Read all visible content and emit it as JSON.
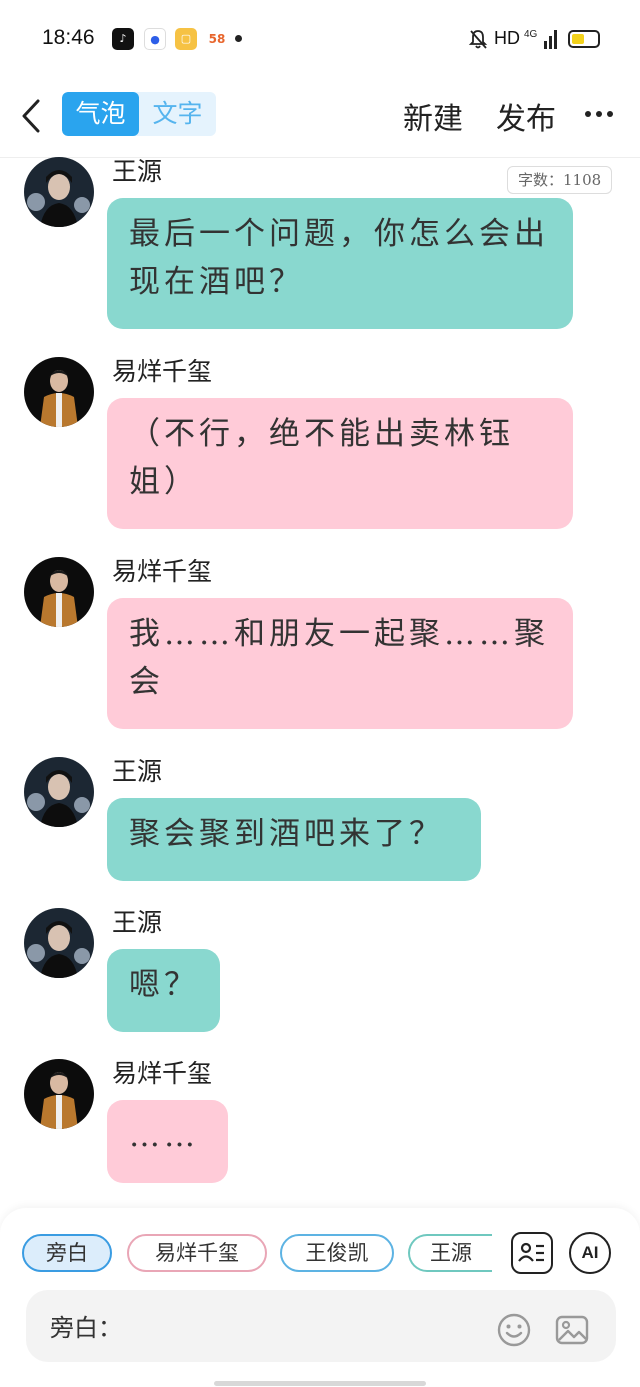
{
  "status_bar": {
    "time": "18:46",
    "app_icons": [
      "tiktok-icon",
      "baidu-icon",
      "notes-icon",
      "58-icon"
    ],
    "app_58_label": "58",
    "network": "HD",
    "signal": "4G",
    "battery_color": "#f3d21b"
  },
  "header": {
    "tabs": [
      {
        "label": "气泡",
        "active": true
      },
      {
        "label": "文字",
        "active": false
      }
    ],
    "new_label": "新建",
    "publish_label": "发布",
    "accent": "#2aa4ee"
  },
  "word_count": "字数：1108",
  "messages": [
    {
      "sender": "王源",
      "text": "最后一个问题，你怎么会出现在酒吧？",
      "style": "teal",
      "avatar": "wang-yuan-avatar"
    },
    {
      "sender": "易烊千玺",
      "text": "（不行，绝不能出卖林钰姐）",
      "style": "pink",
      "avatar": "yi-yang-qianxi-avatar"
    },
    {
      "sender": "易烊千玺",
      "text": "我……和朋友一起聚……聚会",
      "style": "pink",
      "avatar": "yi-yang-qianxi-avatar"
    },
    {
      "sender": "王源",
      "text": "聚会聚到酒吧来了？",
      "style": "teal",
      "avatar": "wang-yuan-avatar"
    },
    {
      "sender": "王源",
      "text": "嗯？",
      "style": "teal",
      "avatar": "wang-yuan-avatar"
    },
    {
      "sender": "易烊千玺",
      "text": "……",
      "style": "pink",
      "avatar": "yi-yang-qianxi-avatar"
    }
  ],
  "bubble_colors": {
    "teal": "#89d8cf",
    "pink": "#ffcbd8"
  },
  "role_chips": [
    "旁白",
    "易烊千玺",
    "王俊凯",
    "王源"
  ],
  "ai_label": "AI",
  "input": {
    "label": "旁白："
  }
}
